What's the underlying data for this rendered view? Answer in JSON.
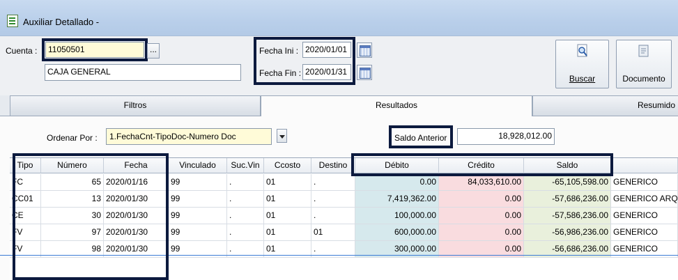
{
  "window": {
    "title": "Auxiliar Detallado -"
  },
  "form": {
    "cuenta_label": "Cuenta :",
    "cuenta_value": "11050501",
    "cuenta_browse_label": "...",
    "cuenta_name": "CAJA GENERAL",
    "fecha_ini_label": "Fecha Ini :",
    "fecha_ini_value": "2020/01/01",
    "fecha_fin_label": "Fecha Fin :",
    "fecha_fin_value": "2020/01/31",
    "buscar_label": "Buscar",
    "documento_label": "Documento"
  },
  "tabs": [
    {
      "label": "Filtros",
      "active": false
    },
    {
      "label": "Resultados",
      "active": true
    },
    {
      "label": "Resumido",
      "active": false
    }
  ],
  "results": {
    "ordenar_label": "Ordenar Por :",
    "ordenar_value": "1.FechaCnt-TipoDoc-Numero Doc",
    "saldo_anterior_label": "Saldo Anterior",
    "saldo_anterior_value": "18,928,012.00"
  },
  "table": {
    "columns": [
      "Tipo",
      "Número",
      "Fecha",
      "Vinculado",
      "Suc.Vin",
      "Ccosto",
      "Destino",
      "Débito",
      "Crédito",
      "Saldo",
      ""
    ],
    "rows": [
      [
        "FC",
        "65",
        "2020/01/16",
        "99",
        ".",
        "01",
        ".",
        "0.00",
        "84,033,610.00",
        "-65,105,598.00",
        "GENERICO"
      ],
      [
        "CC01",
        "13",
        "2020/01/30",
        "99",
        ".",
        "01",
        ".",
        "7,419,362.00",
        "0.00",
        "-57,686,236.00",
        "GENERICO ARQU"
      ],
      [
        "CE",
        "30",
        "2020/01/30",
        "99",
        ".",
        "01",
        ".",
        "100,000.00",
        "0.00",
        "-57,586,236.00",
        "GENERICO"
      ],
      [
        "FV",
        "97",
        "2020/01/30",
        "99",
        ".",
        "01",
        "01",
        "600,000.00",
        "0.00",
        "-56,986,236.00",
        "GENERICO"
      ],
      [
        "FV",
        "98",
        "2020/01/30",
        "99",
        ".",
        "01",
        ".",
        "300,000.00",
        "0.00",
        "-56,686,236.00",
        "GENERICO"
      ]
    ]
  },
  "icons": {
    "window": "document-icon",
    "calendar": "calendar-icon",
    "buscar": "magnifier-icon",
    "documento": "document-icon",
    "dropdown": "chevron-down-icon"
  },
  "colors": {
    "highlight_border": "#0c1a3e",
    "debito_bg": "#d6e9ed",
    "credito_bg": "#f9dcdf",
    "saldo_bg": "#e9f0dc",
    "input_yellow": "#fffbd8"
  }
}
